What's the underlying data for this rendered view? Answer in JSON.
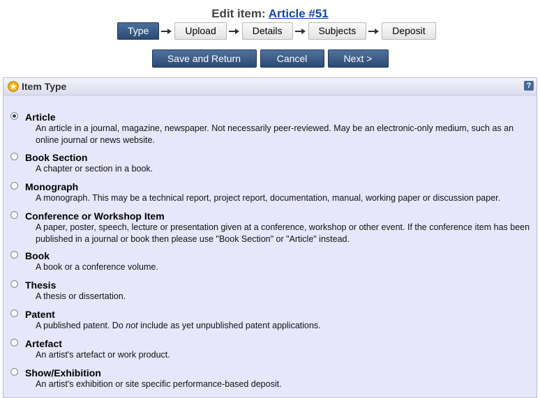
{
  "header": {
    "prefix": "Edit item:",
    "link_text": "Article #51"
  },
  "steps": [
    "Type",
    "Upload",
    "Details",
    "Subjects",
    "Deposit"
  ],
  "active_step": "Type",
  "actions": {
    "save_label": "Save and Return",
    "cancel_label": "Cancel",
    "next_label": "Next >"
  },
  "panel": {
    "title": "Item Type",
    "help_label": "?"
  },
  "selected_type": "Article",
  "types": [
    {
      "name": "Article",
      "desc": "An article in a journal, magazine, newspaper. Not necessarily peer-reviewed. May be an electronic-only medium, such as an online journal or news website."
    },
    {
      "name": "Book Section",
      "desc": "A chapter or section in a book."
    },
    {
      "name": "Monograph",
      "desc": "A monograph. This may be a technical report, project report, documentation, manual, working paper or discussion paper."
    },
    {
      "name": "Conference or Workshop Item",
      "desc": "A paper, poster, speech, lecture or presentation given at a conference, workshop or other event. If the conference item has been published in a journal or book then please use \"Book Section\" or \"Article\" instead."
    },
    {
      "name": "Book",
      "desc": "A book or a conference volume."
    },
    {
      "name": "Thesis",
      "desc": "A thesis or dissertation."
    },
    {
      "name": "Patent",
      "desc_before": "A published patent. Do ",
      "desc_em": "not",
      "desc_after": " include as yet unpublished patent applications."
    },
    {
      "name": "Artefact",
      "desc": "An artist's artefact or work product."
    },
    {
      "name": "Show/Exhibition",
      "desc": "An artist's exhibition or site specific performance-based deposit."
    }
  ],
  "colors": {
    "accent": "#2b4a73",
    "link": "#1447a8",
    "panel_bg": "#e7e7fc"
  }
}
